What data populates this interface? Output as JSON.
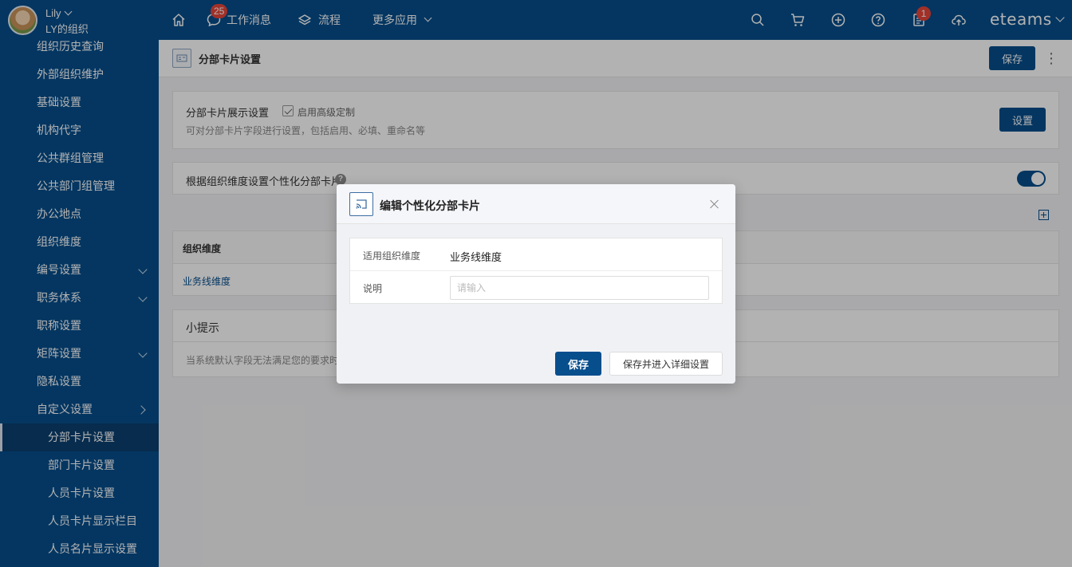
{
  "user": {
    "name": "Lily",
    "org": "LY的组织"
  },
  "topnav": {
    "message_label": "工作消息",
    "message_badge": "25",
    "flow_label": "流程",
    "more_label": "更多应用",
    "todo_badge": "1",
    "brand": "eteams",
    "icons": [
      "home-icon",
      "chat-icon",
      "layers-icon",
      "search-icon",
      "cart-icon",
      "plus-circle-icon",
      "help-icon",
      "todo-icon",
      "cloud-upload-icon"
    ]
  },
  "sidebar": {
    "items": [
      {
        "label": "组织历史查询",
        "sub": false,
        "arrow": ""
      },
      {
        "label": "外部组织维护",
        "sub": false,
        "arrow": ""
      },
      {
        "label": "基础设置",
        "sub": false,
        "arrow": ""
      },
      {
        "label": "机构代字",
        "sub": false,
        "arrow": ""
      },
      {
        "label": "公共群组管理",
        "sub": false,
        "arrow": ""
      },
      {
        "label": "公共部门组管理",
        "sub": false,
        "arrow": ""
      },
      {
        "label": "办公地点",
        "sub": false,
        "arrow": ""
      },
      {
        "label": "组织维度",
        "sub": false,
        "arrow": ""
      },
      {
        "label": "编号设置",
        "sub": false,
        "arrow": "down"
      },
      {
        "label": "职务体系",
        "sub": false,
        "arrow": "down"
      },
      {
        "label": "职称设置",
        "sub": false,
        "arrow": ""
      },
      {
        "label": "矩阵设置",
        "sub": false,
        "arrow": "down"
      },
      {
        "label": "隐私设置",
        "sub": false,
        "arrow": ""
      },
      {
        "label": "自定义设置",
        "sub": false,
        "arrow": "right"
      },
      {
        "label": "分部卡片设置",
        "sub": true,
        "arrow": "",
        "active": true
      },
      {
        "label": "部门卡片设置",
        "sub": true,
        "arrow": ""
      },
      {
        "label": "人员卡片设置",
        "sub": true,
        "arrow": ""
      },
      {
        "label": "人员卡片显示栏目",
        "sub": true,
        "arrow": ""
      },
      {
        "label": "人员名片显示设置",
        "sub": true,
        "arrow": ""
      }
    ]
  },
  "page": {
    "title": "分部卡片设置",
    "save_label": "保存",
    "card_display": {
      "title": "分部卡片展示设置",
      "checkbox_label": "启用高级定制",
      "checkbox_checked": true,
      "desc": "可对分部卡片字段进行设置，包括启用、必填、重命名等",
      "set_label": "设置"
    },
    "personalize": {
      "title": "根据组织维度设置个性化分部卡片",
      "enabled": true
    },
    "table": {
      "header": "组织维度",
      "rows": [
        "业务线维度"
      ]
    },
    "tips": {
      "title": "小提示",
      "body": "当系统默认字段无法满足您的要求时"
    }
  },
  "modal": {
    "title": "编辑个性化分部卡片",
    "dimension_label": "适用组织维度",
    "dimension_value": "业务线维度",
    "desc_label": "说明",
    "desc_placeholder": "请输入",
    "desc_value": "",
    "save_label": "保存",
    "save_detail_label": "保存并进入详细设置"
  }
}
